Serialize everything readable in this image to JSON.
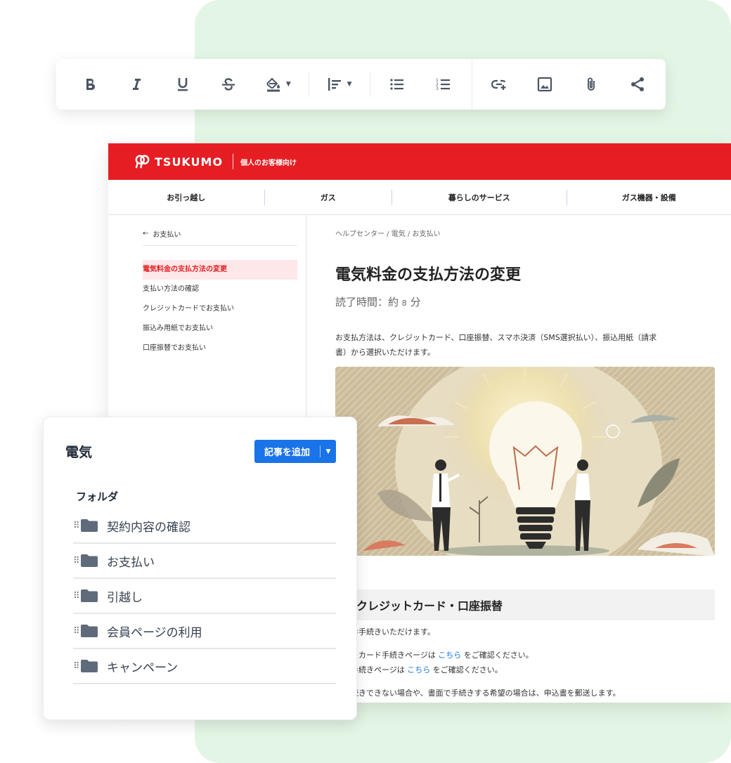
{
  "toolbar": {
    "buttons": [
      "bold-icon",
      "italic-icon",
      "underline-icon",
      "strikethrough-icon",
      "fill-color-icon",
      "align-left-icon",
      "bullet-list-icon",
      "numbered-list-icon",
      "link-icon",
      "image-icon",
      "attachment-icon",
      "share-icon"
    ]
  },
  "site": {
    "brand": "TSUKUMO",
    "header_sub": "個人のお客様向け",
    "nav": [
      "お引っ越し",
      "ガス",
      "暮らしのサービス",
      "ガス機器・設備"
    ],
    "back_label": "お支払い",
    "sidebar": [
      {
        "label": "電気料金の支払方法の変更",
        "active": true
      },
      {
        "label": "支払い方法の確認",
        "active": false
      },
      {
        "label": "クレジットカードでお支払い",
        "active": false
      },
      {
        "label": "振込み用紙でお支払い",
        "active": false
      },
      {
        "label": "口座振替でお支払い",
        "active": false
      }
    ],
    "breadcrumb": "ヘルプセンター / 電気 / お支払い",
    "article_title": "電気料金の支払方法の変更",
    "read_time_prefix": "読了時間：約",
    "read_time_num": "8",
    "read_time_suffix": "分",
    "intro_1": "お支払方法は、クレジットカード、口座振替、スマホ決済（SMS選択払い）、振込用紙（請求",
    "intro_2": "書）から選択いただけます。",
    "section_title": "クレジットカード・口座振替",
    "p1": "期間お手続きいただけます。",
    "p2a": "ジットカード手続きページは",
    "p2link": "こちら",
    "p2b": "をご確認ください。",
    "p3a": "振替手続きページは",
    "p3link": "こちら",
    "p3b": "をご確認ください。",
    "p4": "で手続きできない場合や、書面で手続きする希望の場合は、申込書を郵送します。"
  },
  "card": {
    "title": "電気",
    "add_button": "記事を追加",
    "folder_heading": "フォルダ",
    "folders": [
      "契約内容の確認",
      "お支払い",
      "引越し",
      "会員ページの利用",
      "キャンペーン"
    ]
  },
  "colors": {
    "brand_red": "#e61e23",
    "accent_blue": "#1a73e8",
    "bg_green": "#e3f5e4"
  }
}
